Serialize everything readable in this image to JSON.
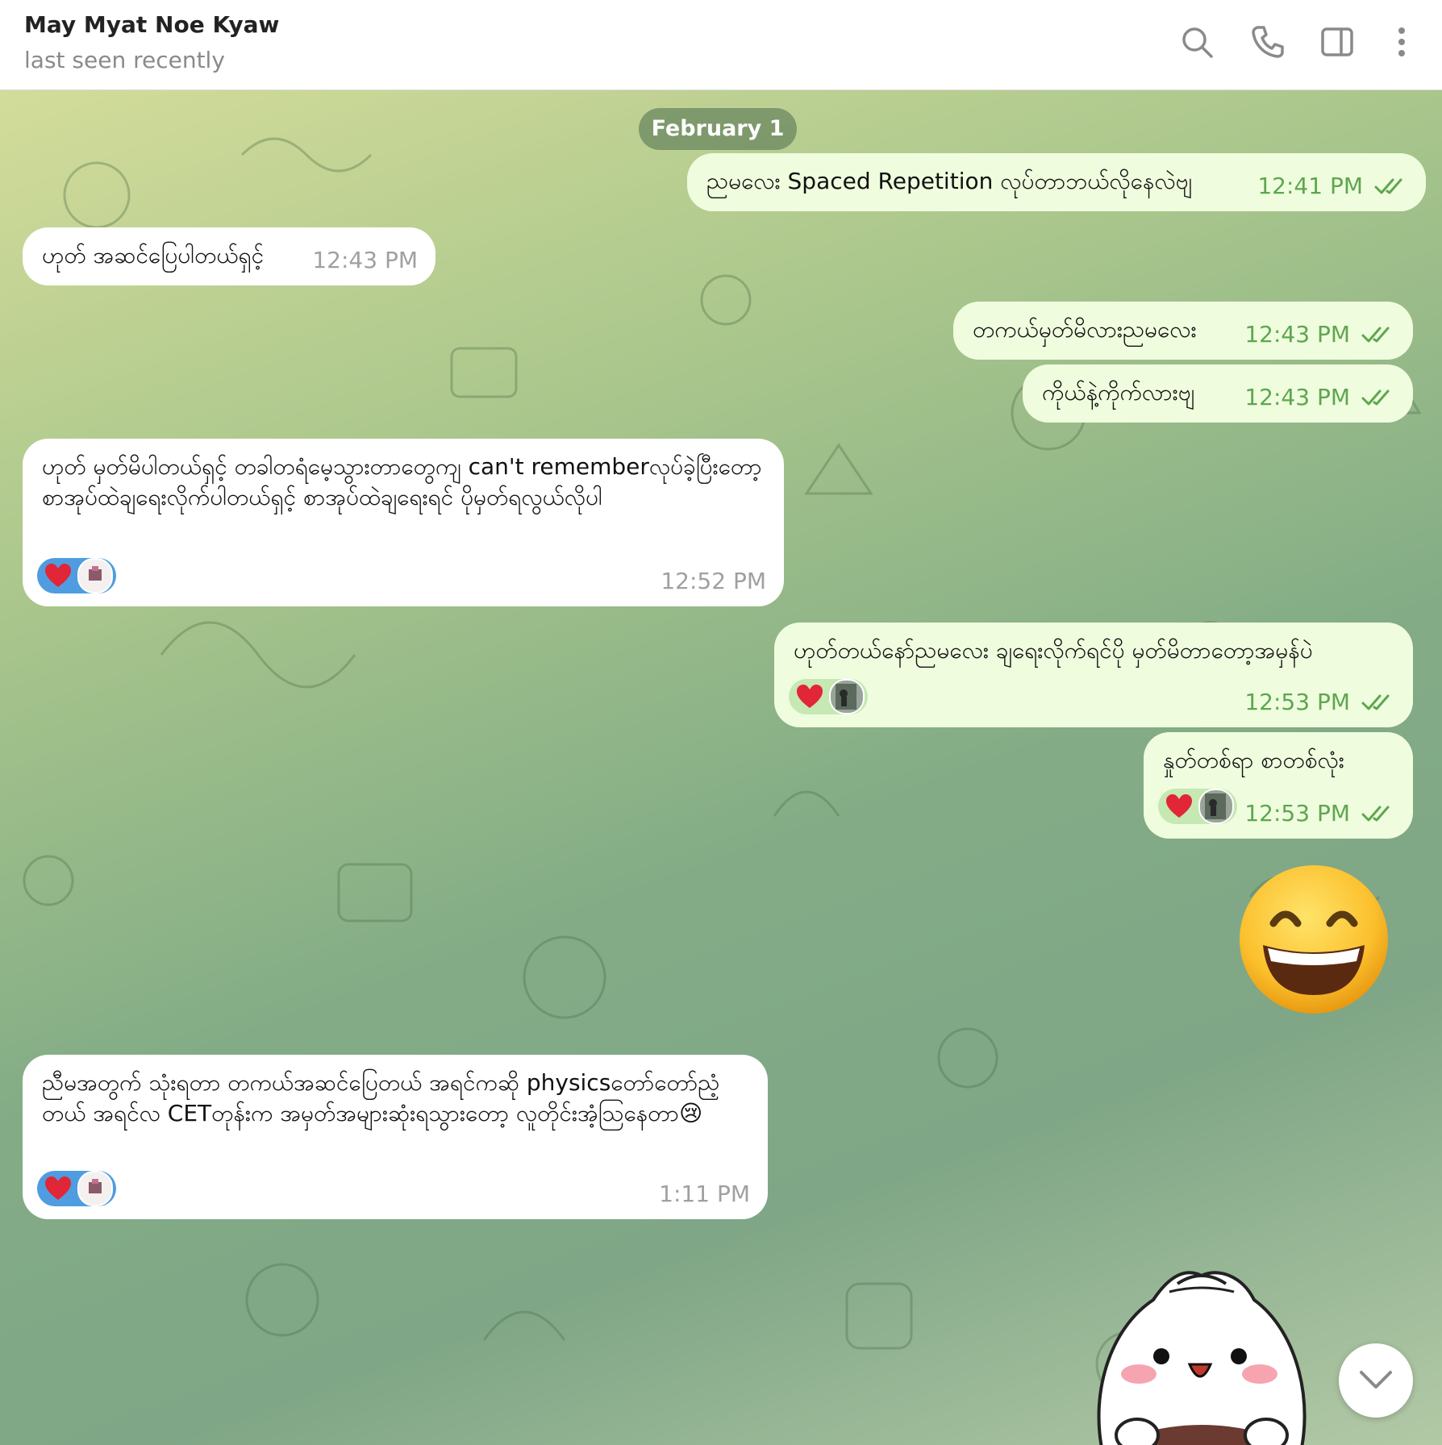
{
  "header": {
    "name": "May Myat Noe Kyaw",
    "status": "last seen recently",
    "icons": [
      "search-icon",
      "phone-icon",
      "sidebar-toggle-icon",
      "more-options-icon"
    ]
  },
  "chat": {
    "date_label": "February 1",
    "messages": [
      {
        "direction": "out",
        "text": "ညမလေး Spaced Repetition လုပ်တာဘယ်လိုနေလဲဗျ",
        "time": "12:41 PM",
        "read": true
      },
      {
        "direction": "in",
        "text": "ဟုတ် အဆင်ပြေပါတယ်ရှင့်",
        "time": "12:43 PM"
      },
      {
        "direction": "out",
        "text": "တကယ်မှတ်မိလားညမလေး",
        "time": "12:43 PM",
        "read": true
      },
      {
        "direction": "out",
        "text": "ကိုယ်နဲ့ကိုက်လားဗျ",
        "time": "12:43 PM",
        "read": true
      },
      {
        "direction": "in",
        "text": "ဟုတ် မှတ်မိပါတယ်ရှင့် တခါတရံမေ့သွားတာတွေကျ can't rememberလုပ်ခဲ့ပြီးတော့ စာအုပ်ထဲချရေးလိုက်ပါတယ်ရှင့် စာအုပ်ထဲချရေးရင် ပိုမှတ်ရလွယ်လိုပါ",
        "time": "12:52 PM",
        "reactions": [
          "heart",
          "avatar"
        ]
      },
      {
        "direction": "out",
        "text": "ဟုတ်တယ်နော်ညမလေး ချရေးလိုက်ရင်ပို မှတ်မိတာတော့အမှန်ပဲ",
        "time": "12:53 PM",
        "read": true,
        "reactions": [
          "heart",
          "avatar"
        ]
      },
      {
        "direction": "out",
        "text": "နှုတ်တစ်ရာ စာတစ်လုံး",
        "time": "12:53 PM",
        "read": true,
        "reactions": [
          "heart",
          "avatar"
        ]
      },
      {
        "direction": "out",
        "type": "emoji",
        "emoji": "grinning-face-with-smiling-eyes"
      },
      {
        "direction": "in",
        "text": "ညီမအတွက် သုံးရတာ တကယ်အဆင်ပြေတယ် အရင်ကဆို physicsတော်တော်ညံ့တယ် အရင်လ CETတုန်းက အမှတ်အများဆုံးရသွားတော့ လူတိုင်းအံ့သြနေတာ😢",
        "time": "1:11 PM",
        "reactions": [
          "heart",
          "avatar"
        ]
      }
    ],
    "sticker": "dumpling-character-sticker",
    "scroll_button": "chevron-down-icon"
  },
  "colors": {
    "outgoing_bubble": "#effdde",
    "incoming_bubble": "#ffffff",
    "read_ticks": "#5ea64f",
    "incoming_time": "#a0a0a0",
    "reaction_in": "#4f9de0",
    "reaction_out": "#c6e8b3"
  }
}
